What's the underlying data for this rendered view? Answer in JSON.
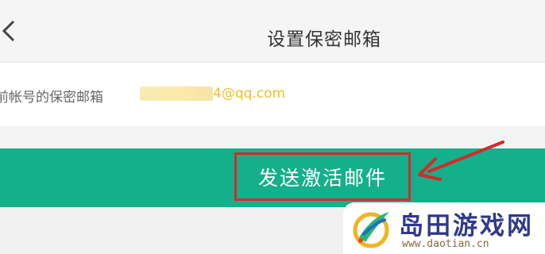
{
  "header": {
    "back_icon": "chevron-left-icon",
    "title": "设置保密邮箱"
  },
  "email": {
    "label": "前帐号的保密邮箱",
    "masked_value_visible": "4@qq.com"
  },
  "send": {
    "button_label": "发送激活邮件",
    "accent_color": "#14b08b",
    "highlight_color": "#d42a2a"
  },
  "watermark": {
    "name": "岛田游戏网",
    "url": "www.daotian.cn"
  }
}
